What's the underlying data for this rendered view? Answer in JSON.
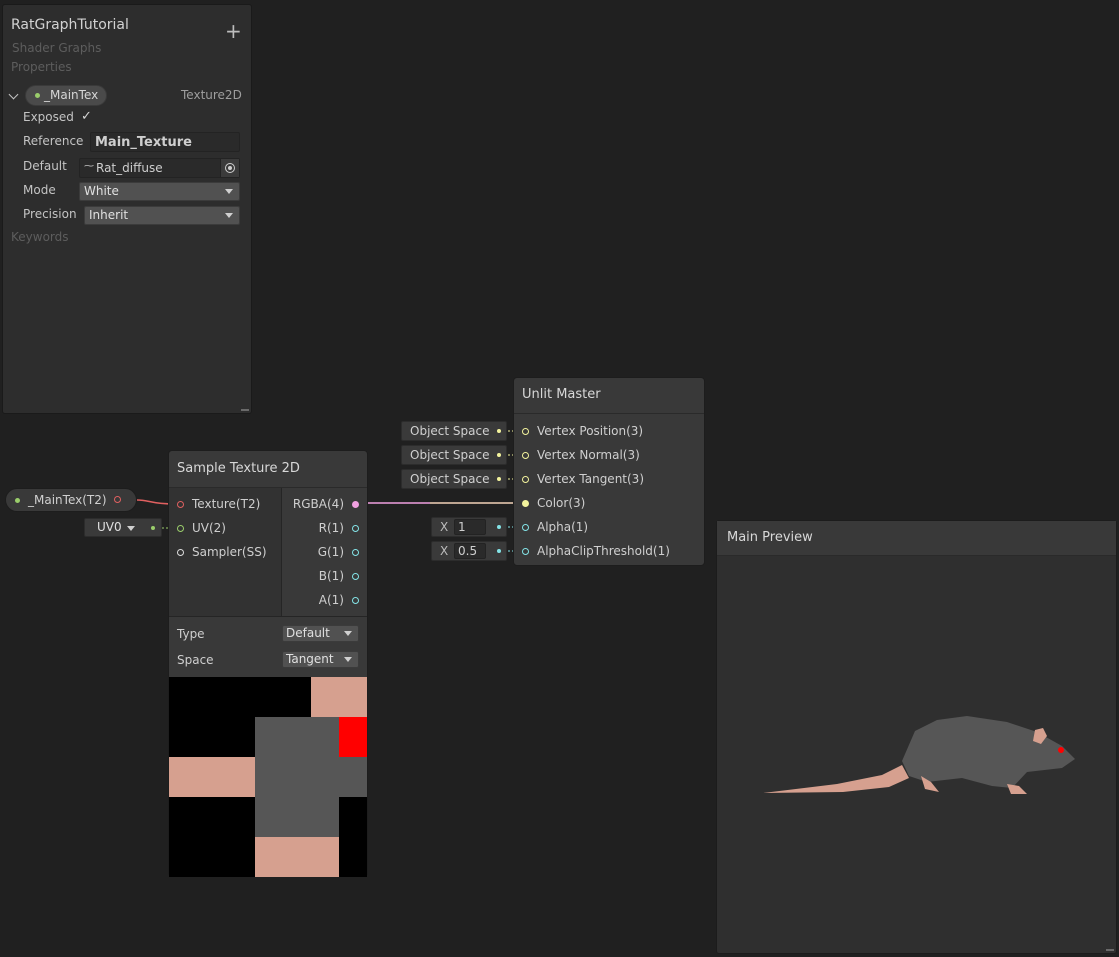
{
  "blackboard": {
    "title": "RatGraphTutorial",
    "subtitle": "Shader Graphs",
    "add_icon": "plus-icon",
    "properties_header": "Properties",
    "property": {
      "name": "_MainTex",
      "type": "Texture2D",
      "exposed_label": "Exposed",
      "exposed": true,
      "reference_label": "Reference",
      "reference_value": "Main_Texture",
      "default_label": "Default",
      "default_value": "Rat_diffuse",
      "mode_label": "Mode",
      "mode_value": "White",
      "precision_label": "Precision",
      "precision_value": "Inherit"
    },
    "keywords_header": "Keywords"
  },
  "property_node": {
    "label": "_MainTex(T2)"
  },
  "uv_dropdown": {
    "value": "UV0"
  },
  "sample_node": {
    "title": "Sample Texture 2D",
    "inputs": [
      "Texture(T2)",
      "UV(2)",
      "Sampler(SS)"
    ],
    "outputs": [
      "RGBA(4)",
      "R(1)",
      "G(1)",
      "B(1)",
      "A(1)"
    ],
    "type_label": "Type",
    "type_value": "Default",
    "space_label": "Space",
    "space_value": "Tangent"
  },
  "master_node": {
    "title": "Unlit Master",
    "ports": [
      "Vertex Position(3)",
      "Vertex Normal(3)",
      "Vertex Tangent(3)",
      "Color(3)",
      "Alpha(1)",
      "AlphaClipThreshold(1)"
    ],
    "space_chips": [
      "Object Space",
      "Object Space",
      "Object Space"
    ],
    "alpha_x_label": "X",
    "alpha_value": "1",
    "clip_x_label": "X",
    "clip_value": "0.5"
  },
  "main_preview": {
    "title": "Main Preview"
  },
  "colors": {
    "background": "#202020",
    "texture_port": "#e06060",
    "vector2_port": "#9acd6b",
    "vector3_port": "#f3f39d",
    "vector4_port": "#f0a0e0",
    "float_port": "#84e4e7",
    "rat_body": "#565656",
    "rat_pink": "#d6a08f",
    "rat_eye": "#ff0000"
  }
}
